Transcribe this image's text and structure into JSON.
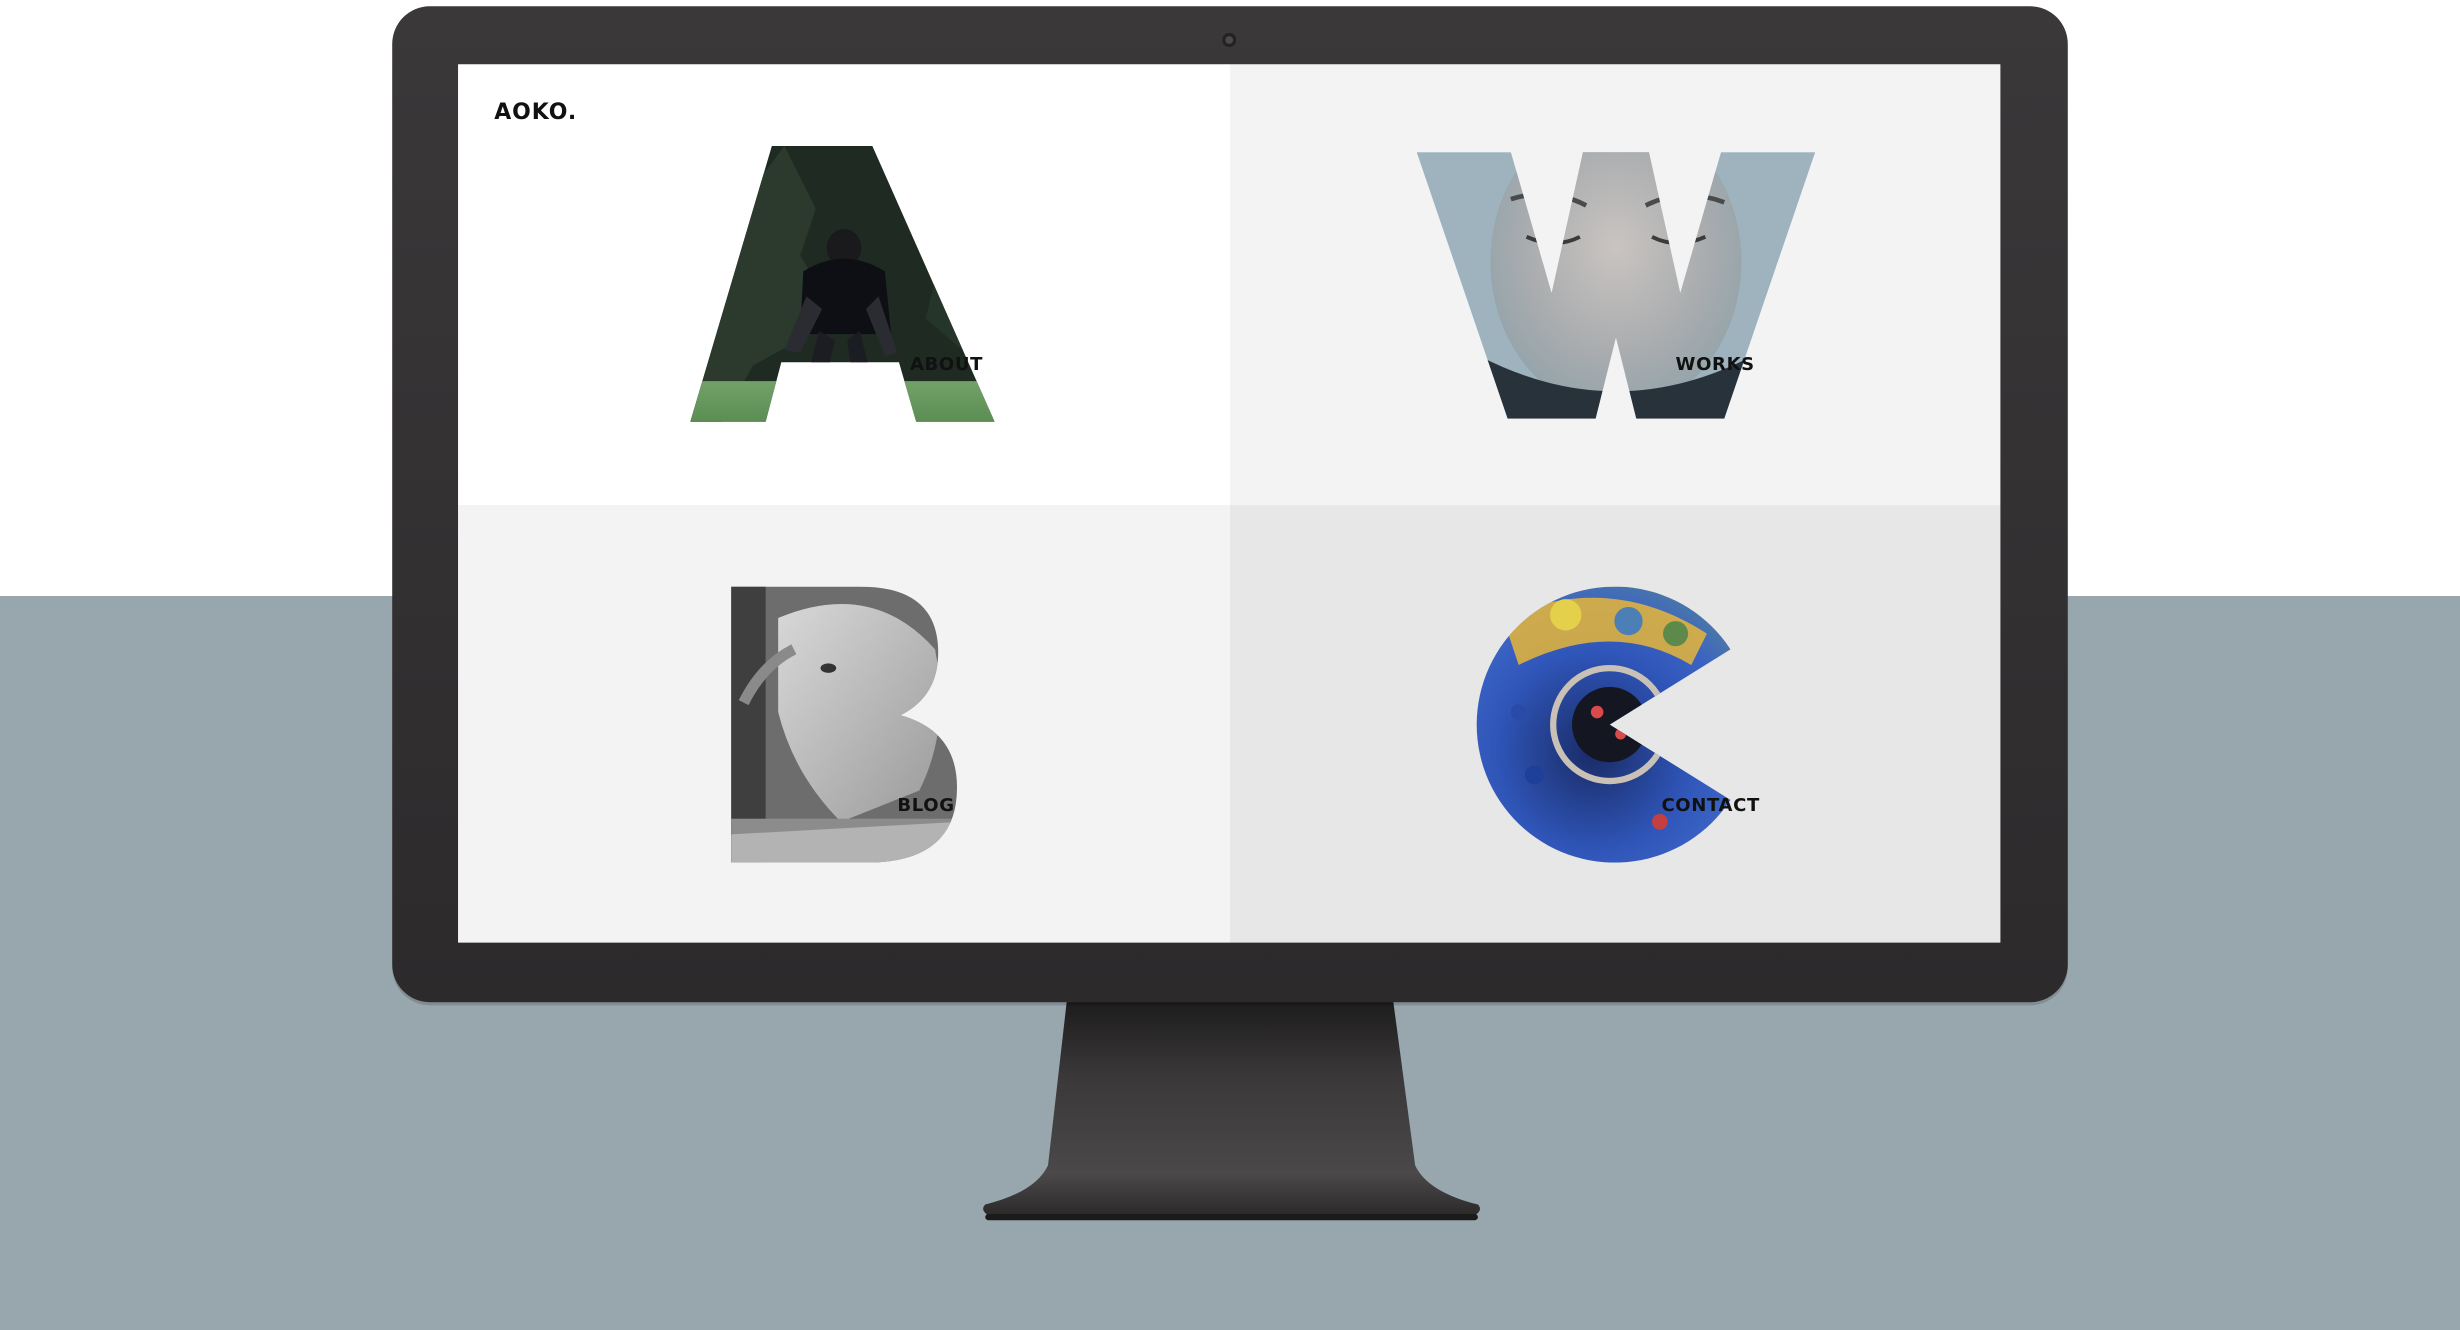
{
  "site": {
    "logo": "AOKO."
  },
  "tiles": [
    {
      "id": "about",
      "letter_icon": "letter-a-photo-icon",
      "label": "ABOUT"
    },
    {
      "id": "works",
      "letter_icon": "letter-w-photo-icon",
      "label": "WORKS"
    },
    {
      "id": "blog",
      "letter_icon": "letter-b-photo-icon",
      "label": "BLOG"
    },
    {
      "id": "contact",
      "letter_icon": "letter-c-photo-icon",
      "label": "CONTACT"
    }
  ],
  "colors": {
    "floor": "#98a6ad",
    "wall": "#ffffff",
    "monitor_bezel": "#2e2c2d",
    "tile_about": "#ffffff",
    "tile_works": "#f3f3f3",
    "tile_blog": "#f3f3f3",
    "tile_contact": "#e7e7e8"
  }
}
